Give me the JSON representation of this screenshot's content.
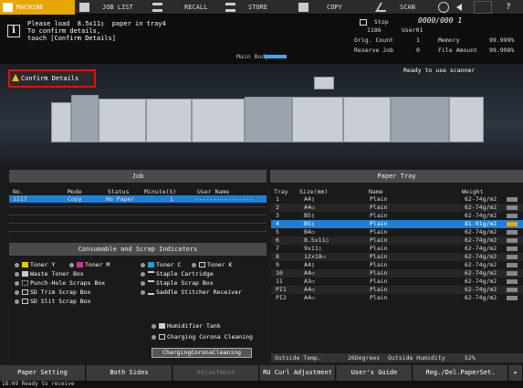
{
  "tabs": [
    {
      "label": "MACHINE",
      "icon": "machine-icon",
      "active": true
    },
    {
      "label": "JOB LIST",
      "icon": "job-list-icon",
      "active": false
    },
    {
      "label": "RECALL",
      "icon": "recall-icon",
      "active": false
    },
    {
      "label": "STORE",
      "icon": "store-icon",
      "active": false
    },
    {
      "label": "COPY",
      "icon": "copy-icon",
      "active": false
    },
    {
      "label": "SCAN",
      "icon": "scan-icon",
      "active": false
    }
  ],
  "message": {
    "line1": "Please load  8.5x11▯  paper in tray4",
    "line2": "To confirm details,",
    "line3": "touch [Confirm Details]"
  },
  "status": {
    "state": "Stop",
    "counter": "0000/000 1",
    "user_count": "1186",
    "user": "User01",
    "orig_count_label": "Orig. Count",
    "orig_count": "1",
    "memory_label": "Memory",
    "memory": "99.999%",
    "reserve_label": "Reserve Job",
    "reserve": "0",
    "file_amount_label": "File Amount",
    "file_amount": "99.998%"
  },
  "main_body_label": "Main Body",
  "confirm_details_label": "Confirm Details",
  "ready_text": "Ready to use scanner",
  "job": {
    "title": "Job",
    "columns": [
      "No.",
      "Mode",
      "Status",
      "Minute(S)",
      "User Name"
    ],
    "rows": [
      {
        "no": "1217",
        "mode": "Copy",
        "status": "No Paper",
        "minutes": "1",
        "user": "----------------"
      }
    ]
  },
  "consumables": {
    "title": "Consumable and Scrap Indicators",
    "items": [
      {
        "label": "Toner Y",
        "color": "#f2c200"
      },
      {
        "label": "Toner M",
        "color": "#d0329a"
      },
      {
        "label": "Toner C",
        "color": "#1ea0e0"
      },
      {
        "label": "Toner K",
        "color": "#222222"
      },
      {
        "label": "Waste Toner Box"
      },
      {
        "label": "Staple Cartridge"
      },
      {
        "label": "Punch-Hole Scraps Box"
      },
      {
        "label": "Staple Scrap Box"
      },
      {
        "label": "SD Trim Scrap Box"
      },
      {
        "label": "Saddle Stitcher Receiver"
      },
      {
        "label": "SD Slit Scrap Box"
      },
      {
        "label": "Humidifier Tank"
      },
      {
        "label": "Charging Corona Cleaning"
      }
    ],
    "corona_button": "ChargingCoronaCleaning"
  },
  "tray": {
    "title": "Paper Tray",
    "columns": [
      "Tray",
      "Size(mm)",
      "Name",
      "Weight"
    ],
    "rows": [
      {
        "tray": "1",
        "size": "A4▯",
        "name": "Plain",
        "weight": "62-74g/m2"
      },
      {
        "tray": "2",
        "size": "A4▭",
        "name": "Plain",
        "weight": "62-74g/m2"
      },
      {
        "tray": "3",
        "size": "B5▯",
        "name": "Plain",
        "weight": "62-74g/m2"
      },
      {
        "tray": "4",
        "size": "B5▯",
        "name": "Plain",
        "weight": "81-91g/m2"
      },
      {
        "tray": "5",
        "size": "B4▭",
        "name": "Plain",
        "weight": "62-74g/m2"
      },
      {
        "tray": "6",
        "size": "8.5x11▯",
        "name": "Plain",
        "weight": "62-74g/m2"
      },
      {
        "tray": "7",
        "size": "9x11▯",
        "name": "Plain",
        "weight": "62-74g/m2"
      },
      {
        "tray": "8",
        "size": "12x18▭",
        "name": "Plain",
        "weight": "62-74g/m2"
      },
      {
        "tray": "9",
        "size": "A4▯",
        "name": "Plain",
        "weight": "62-74g/m2"
      },
      {
        "tray": "10",
        "size": "A4▭",
        "name": "Plain",
        "weight": "62-74g/m2"
      },
      {
        "tray": "11",
        "size": "A3▭",
        "name": "Plain",
        "weight": "62-74g/m2"
      },
      {
        "tray": "PI1",
        "size": "A4▭",
        "name": "Plain",
        "weight": "62-74g/m2"
      },
      {
        "tray": "PI2",
        "size": "A4▭",
        "name": "Plain",
        "weight": "62-74g/m2"
      }
    ],
    "outside_temp_label": "Outside Temp.",
    "outside_temp": "26Degrees",
    "outside_humidity_label": "Outside Humidity",
    "outside_humidity": "52%"
  },
  "bottom_buttons": [
    "Paper Setting",
    "Both Sides",
    "Adjustment",
    "RU Curl Adjustment",
    "User's Guide",
    "Reg./Del.PaperSet."
  ],
  "footer": "18:09  Ready to receive"
}
